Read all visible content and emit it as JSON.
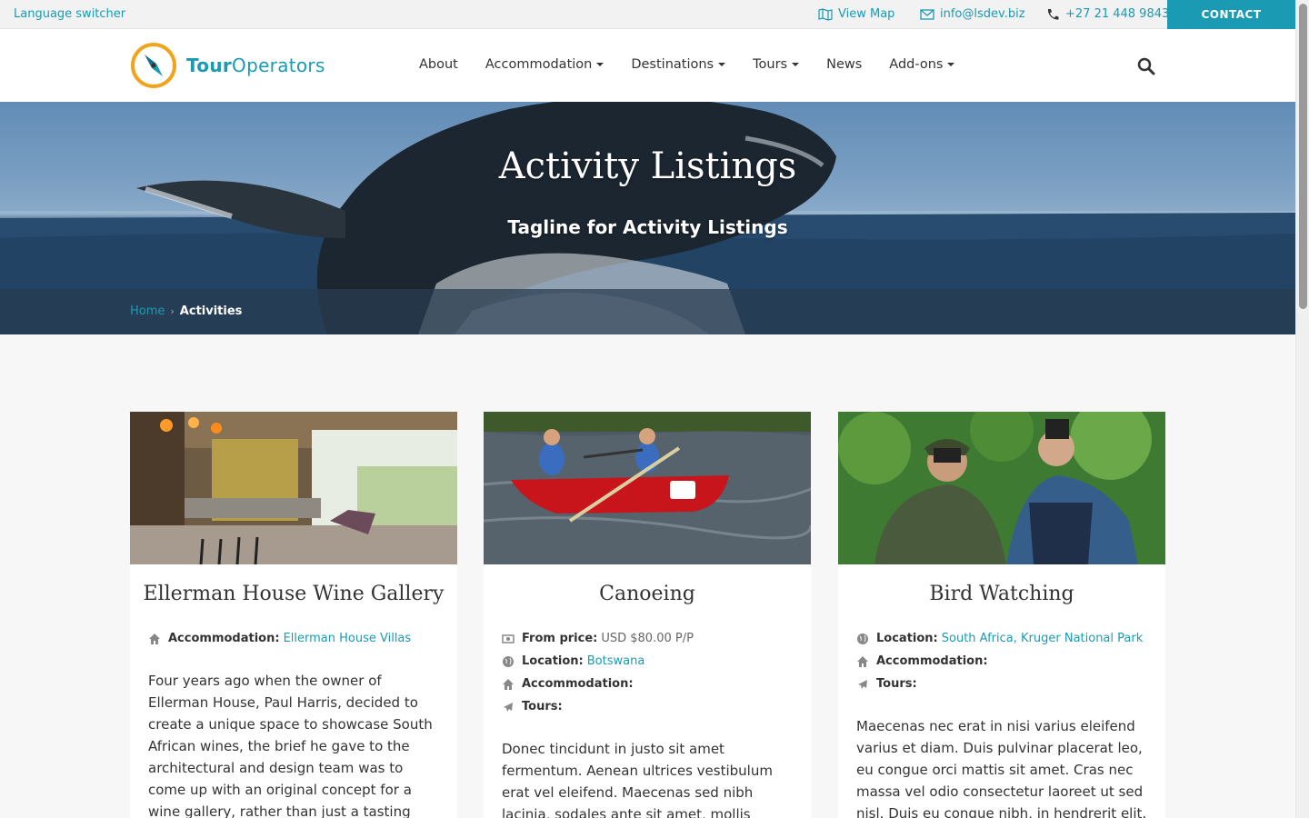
{
  "topbar": {
    "language_switcher": "Language switcher",
    "view_map": "View Map",
    "email": "info@lsdev.biz",
    "phone": "+27 21 448 9843",
    "contact": "CONTACT"
  },
  "header": {
    "logo_bold": "Tour",
    "logo_rest": "Operators",
    "nav": [
      "About",
      "Accommodation",
      "Destinations",
      "Tours",
      "News",
      "Add-ons"
    ]
  },
  "hero": {
    "title": "Activity Listings",
    "tagline": "Tagline for Activity Listings"
  },
  "breadcrumb": {
    "home": "Home",
    "current": "Activities"
  },
  "cards": [
    {
      "title": "Ellerman House Wine Gallery",
      "accommodation_label": "Accommodation:",
      "accommodation_value": "Ellerman House Villas",
      "description": "Four years ago when the owner of Ellerman House, Paul Harris, decided to create a unique space to showcase South African wines, the brief he gave to the architectural and design team was to come up with an original concept for a wine gallery, rather than just a tasting room…"
    },
    {
      "title": "Canoeing",
      "price_label": "From price:",
      "price_value": "USD $80.00 P/P",
      "location_label": "Location:",
      "location_value": "Botswana",
      "accommodation_label": "Accommodation:",
      "tours_label": "Tours:",
      "description": "Donec tincidunt in justo sit amet fermentum. Aenean ultrices vestibulum erat vel eleifend. Maecenas sed nibh lacinia, sodales ante sit amet, mollis quam. Fusce elementum nulla"
    },
    {
      "title": "Bird Watching",
      "location_label": "Location:",
      "location_value": "South Africa, Kruger National Park",
      "accommodation_label": "Accommodation:",
      "tours_label": "Tours:",
      "description": "Maecenas nec erat in nisi varius eleifend varius et diam. Duis pulvinar placerat leo, eu congue orci mattis sit amet. Cras nec massa vel odio consectetur laoreet ut sed nisl. Duis eu congue nibh, in hendrerit elit. Nam"
    }
  ],
  "colors": {
    "accent": "#1a9bb3",
    "logo_ring": "#f0a41c"
  }
}
